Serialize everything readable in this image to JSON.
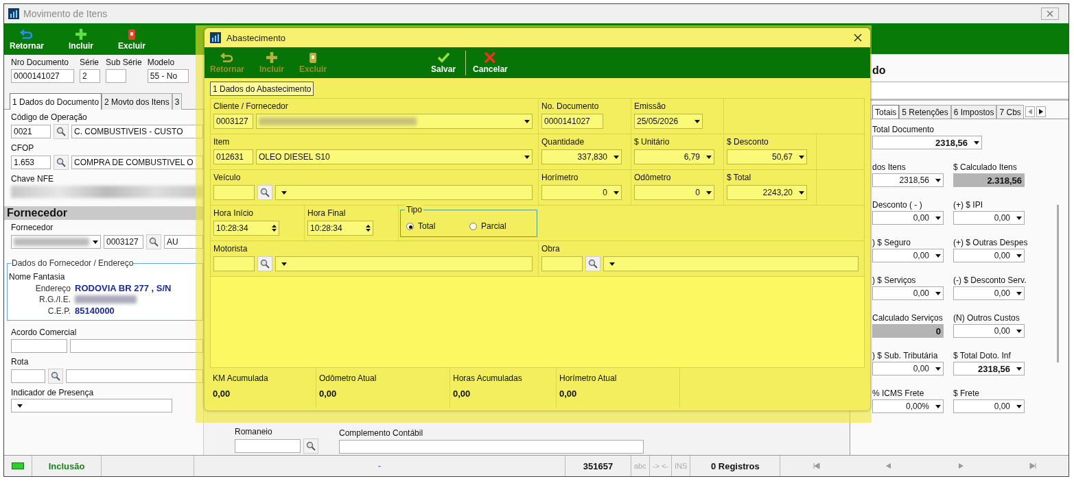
{
  "window": {
    "title": "Movimento de Itens"
  },
  "toolbar": [
    {
      "label": "Retornar",
      "kind": "return"
    },
    {
      "label": "Incluir",
      "kind": "add"
    },
    {
      "label": "Excluir",
      "kind": "delete"
    }
  ],
  "header_fields": [
    {
      "label": "Nro Documento",
      "value": "0000141027"
    },
    {
      "label": "Série",
      "value": "2"
    },
    {
      "label": "Sub Série"
    },
    {
      "label": "Modelo",
      "value": "55 - No"
    }
  ],
  "tabs": [
    {
      "label": "1 Dados do Documento",
      "selected": true
    },
    {
      "label": "2 Movto dos Itens",
      "selected": false
    },
    {
      "label": "3",
      "selected": false
    }
  ],
  "left_fields": [
    {
      "kind": "lookup",
      "label": "Código de Operação",
      "code": "0021",
      "description": "C. COMBUSTIVEIS - CUSTO"
    },
    {
      "kind": "lookup",
      "label": "CFOP",
      "code": "1.653",
      "description": "COMPRA DE COMBUSTIVEL O"
    },
    {
      "kind": "redacted",
      "label": "Chave NFE"
    },
    {
      "kind": "section",
      "label": "Fornecedor"
    },
    {
      "kind": "supplier",
      "label": "Fornecedor",
      "code": "0003127",
      "column_3": "AU"
    },
    {
      "kind": "group",
      "label": "Dados do Fornecedor / Endereço",
      "subtitle": "Nome Fantasia",
      "rows": [
        {
          "label": "Endereço",
          "value": "RODOVIA BR 277 , S/N",
          "redacted": false
        },
        {
          "label": "R.G./I.E.",
          "redacted": true
        },
        {
          "label": "C.E.P.",
          "value": "85140000",
          "redacted": false
        }
      ]
    },
    {
      "kind": "pair",
      "label": "Acordo Comercial"
    },
    {
      "kind": "search",
      "label": "Rota"
    },
    {
      "kind": "dropdown",
      "label": "Indicador de Presença"
    }
  ],
  "middle_fields": [
    {
      "kind": "search",
      "label": "Romaneio"
    },
    {
      "kind": "text",
      "label": "Complemento Contábil"
    }
  ],
  "totals_panel": {
    "heading": "do",
    "tabs": [
      {
        "label": "Totais",
        "selected": true
      },
      {
        "label": "5 Retenções",
        "selected": false
      },
      {
        "label": "6 Impostos",
        "selected": false
      },
      {
        "label": "7 Cbs",
        "selected": false
      }
    ],
    "fields": [
      {
        "kind": "total",
        "label": "Total Documento",
        "value": "2318,56",
        "bold": true
      },
      {
        "kind": "dropdown",
        "label": "dos Itens",
        "value": "2318,56",
        "bold": false
      },
      {
        "kind": "computed",
        "label": "$ Calculado Itens",
        "value": "2.318,56",
        "bold": true
      },
      {
        "kind": "dropdown",
        "label": "Desconto ( - )",
        "value": "0,00",
        "bold": false
      },
      {
        "kind": "dropdown",
        "label": "(+) $ IPI",
        "value": "0,00",
        "bold": false
      },
      {
        "kind": "dropdown",
        "label": ") $ Seguro",
        "value": "0,00",
        "bold": false
      },
      {
        "kind": "dropdown",
        "label": "(+) $ Outras Despes",
        "value": "0,00",
        "bold": false
      },
      {
        "kind": "dropdown",
        "label": ") $ Serviços",
        "value": "0,00",
        "bold": false
      },
      {
        "kind": "dropdown",
        "label": "(-) $ Desconto Serv.",
        "value": "0,00",
        "bold": false
      },
      {
        "kind": "computed",
        "label": "Calculado Serviços",
        "value": "0",
        "bold": true
      },
      {
        "kind": "dropdown",
        "label": "(N) Outros Custos",
        "value": "0,00",
        "bold": false
      },
      {
        "kind": "dropdown",
        "label": ") $ Sub. Tributária",
        "value": "0,00",
        "bold": false
      },
      {
        "kind": "dropdown",
        "label": "$ Total Doto. Inf",
        "value": "2318,56",
        "bold": true
      },
      {
        "kind": "dropdown",
        "label": "% ICMS Frete",
        "value": "0,00%",
        "bold": false
      },
      {
        "kind": "dropdown",
        "label": "$ Frete",
        "value": "0,00",
        "bold": false
      }
    ]
  },
  "status_bar": {
    "mode": "Inclusão",
    "message": "-",
    "number": "351657",
    "indicators": [
      "abc",
      "-> <-",
      "INS"
    ],
    "records": "0 Registros"
  },
  "dialog": {
    "title": "Abastecimento",
    "toolbar": [
      {
        "label": "Retornar",
        "kind": "return",
        "disabled": true
      },
      {
        "label": "Incluir",
        "kind": "add",
        "disabled": true
      },
      {
        "label": "Excluir",
        "kind": "delete",
        "disabled": true
      },
      {
        "label": "Salvar",
        "kind": "save",
        "disabled": false
      },
      {
        "label": "Cancelar",
        "kind": "cancel",
        "disabled": false
      }
    ],
    "tabs": [
      {
        "label": "1 Dados do Abastecimento",
        "selected": true
      }
    ],
    "rows": [
      {
        "cells": [
          {
            "kind": "lookup",
            "label": "Cliente / Fornecedor",
            "code": "0003127",
            "redacted": true
          },
          {
            "kind": "text",
            "label": "No. Documento",
            "value": "0000141027"
          },
          {
            "kind": "date",
            "label": "Emissão",
            "value": "25/05/2026"
          }
        ]
      },
      {
        "cells": [
          {
            "kind": "lookup",
            "label": "Item",
            "code": "012631",
            "value": "OLEO DIESEL S10",
            "redacted": false
          },
          {
            "kind": "number",
            "label": "Quantidade",
            "value": "337,830"
          },
          {
            "kind": "number",
            "label": "$ Unitário",
            "value": "6,79"
          },
          {
            "kind": "number",
            "label": "$ Desconto",
            "value": "50,67"
          }
        ]
      },
      {
        "cells": [
          {
            "kind": "search_lookup",
            "label": "Veículo"
          },
          {
            "kind": "number",
            "label": "Horímetro",
            "value": "0"
          },
          {
            "kind": "number",
            "label": "Odômetro",
            "value": "0"
          },
          {
            "kind": "number",
            "label": "$ Total",
            "value": "2243,20"
          }
        ]
      },
      {
        "cells": [
          {
            "kind": "time",
            "label": "Hora Início",
            "value": "10:28:34"
          },
          {
            "kind": "time",
            "label": "Hora Final",
            "value": "10:28:34"
          },
          {
            "kind": "radio_group",
            "label": "Tipo",
            "options": [
              {
                "label": "Total",
                "selected": true
              },
              {
                "label": "Parcial",
                "selected": false
              }
            ]
          }
        ]
      },
      {
        "cells": [
          {
            "kind": "search_lookup",
            "label": "Motorista"
          },
          {
            "kind": "search_lookup",
            "label": "Obra"
          }
        ]
      }
    ],
    "summary": [
      {
        "label": "KM Acumulada",
        "value": "0,00"
      },
      {
        "label": "Odômetro Atual",
        "value": "0,00"
      },
      {
        "label": "Horas Acumuladas",
        "value": "0,00"
      },
      {
        "label": "Horímetro Atual",
        "value": "0,00"
      }
    ]
  }
}
